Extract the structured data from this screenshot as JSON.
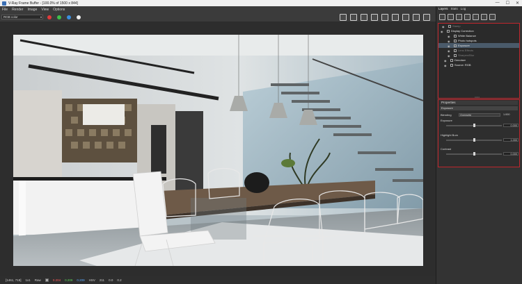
{
  "window": {
    "title": "V-Ray Frame Buffer - [100.0% of 1500 x 844]",
    "controls": [
      "—",
      "☐",
      "✕"
    ]
  },
  "menu": [
    "File",
    "Render",
    "Image",
    "View",
    "Options"
  ],
  "toolbar": {
    "channel": "RGB color"
  },
  "status": {
    "coords": "[1461, 718]",
    "zoom_label": "1x1",
    "mode": "Raw",
    "r": "0.204",
    "g": "0.209",
    "b": "0.209",
    "hsv_label": "HSV",
    "h": "211",
    "s": "0.0",
    "v": "0.2"
  },
  "panel": {
    "tabs": [
      "Layers",
      "Stats",
      "Log"
    ],
    "layers": [
      {
        "label": "Stamp",
        "dim": true,
        "indent": 1
      },
      {
        "label": "Display Correction",
        "dim": false,
        "indent": 0
      },
      {
        "label": "White Balance",
        "dim": false,
        "indent": 2
      },
      {
        "label": "Photo hotspots",
        "dim": false,
        "indent": 2
      },
      {
        "label": "Exposure",
        "dim": false,
        "indent": 2,
        "selected": true
      },
      {
        "label": "Lens Effects",
        "dim": true,
        "indent": 2
      },
      {
        "label": "Sharpen/Blur",
        "dim": true,
        "indent": 2
      },
      {
        "label": "Denoiser",
        "dim": false,
        "indent": 1
      },
      {
        "label": "Source: RGB",
        "dim": false,
        "indent": 1
      }
    ],
    "properties": {
      "header": "Properties",
      "section": "Exposure",
      "mode_label": "Blending",
      "mode_value": "Overwrite",
      "mode_amount": "1.000",
      "sliders": [
        {
          "label": "Exposure",
          "value": "0.000",
          "pos": 0.5
        },
        {
          "label": "Highlight Burn",
          "value": "1.000",
          "pos": 0.5
        },
        {
          "label": "Contrast",
          "value": "0.000",
          "pos": 0.5
        }
      ]
    }
  },
  "colors": {
    "accent_red": "#c0262d",
    "dot_red": "#e03b3b",
    "dot_green": "#3fbf4a",
    "dot_blue": "#3b8fe0"
  }
}
